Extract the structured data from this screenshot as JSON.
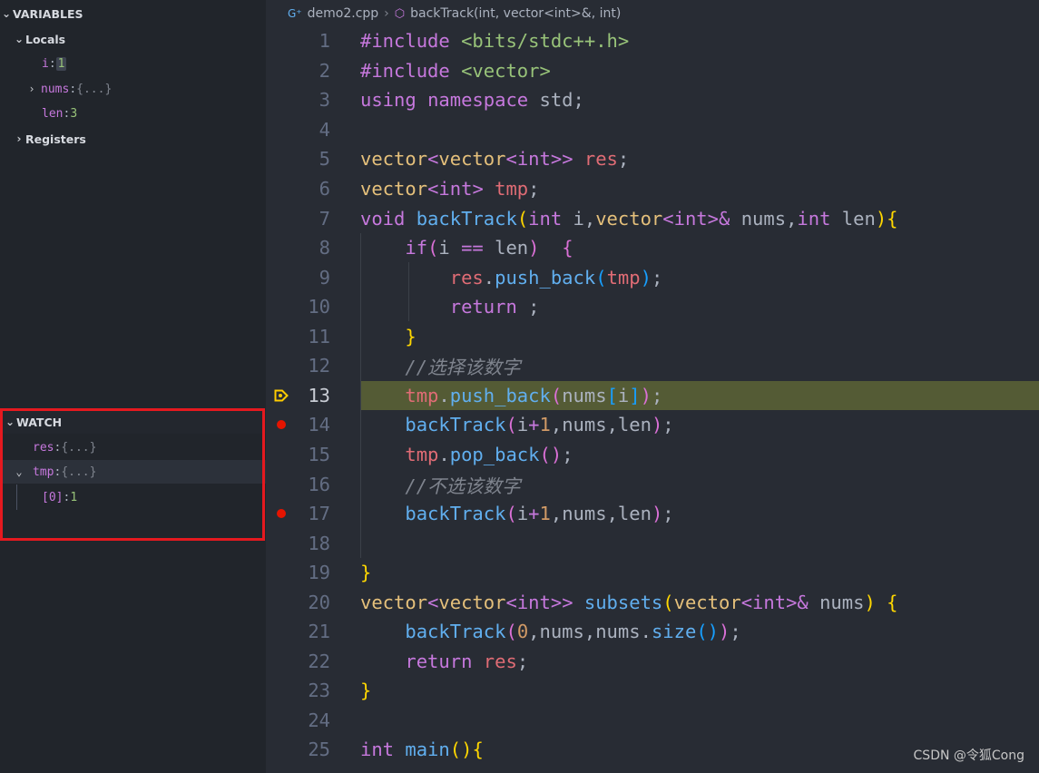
{
  "variables": {
    "title": "VARIABLES",
    "locals_label": "Locals",
    "locals": [
      {
        "name": "i",
        "value": "1"
      },
      {
        "name": "nums",
        "value": "{...}"
      },
      {
        "name": "len",
        "value": "3"
      }
    ],
    "registers_label": "Registers"
  },
  "watch": {
    "title": "WATCH",
    "items": [
      {
        "name": "res",
        "value": "{...}"
      },
      {
        "name": "tmp",
        "value": "{...}"
      },
      {
        "name": "[0]",
        "value": "1"
      }
    ]
  },
  "breadcrumb": {
    "file": "demo2.cpp",
    "symbol": "backTrack(int, vector<int>&, int)"
  },
  "editor": {
    "current_line": 13,
    "breakpoints": [
      14,
      17
    ],
    "lines": [
      {
        "n": "1",
        "text": "#include <bits/stdc++.h>"
      },
      {
        "n": "2",
        "text": "#include <vector>"
      },
      {
        "n": "3",
        "text": "using namespace std;"
      },
      {
        "n": "4",
        "text": ""
      },
      {
        "n": "5",
        "text": "vector<vector<int>> res;"
      },
      {
        "n": "6",
        "text": "vector<int> tmp;"
      },
      {
        "n": "7",
        "text": "void backTrack(int i,vector<int>& nums,int len){"
      },
      {
        "n": "8",
        "text": "    if(i == len)  {"
      },
      {
        "n": "9",
        "text": "        res.push_back(tmp);"
      },
      {
        "n": "10",
        "text": "        return ;"
      },
      {
        "n": "11",
        "text": "    }"
      },
      {
        "n": "12",
        "text": "    //选择该数字"
      },
      {
        "n": "13",
        "text": "    tmp.push_back(nums[i]);"
      },
      {
        "n": "14",
        "text": "    backTrack(i+1,nums,len);"
      },
      {
        "n": "15",
        "text": "    tmp.pop_back();"
      },
      {
        "n": "16",
        "text": "    //不选该数字"
      },
      {
        "n": "17",
        "text": "    backTrack(i+1,nums,len);"
      },
      {
        "n": "18",
        "text": ""
      },
      {
        "n": "19",
        "text": "}"
      },
      {
        "n": "20",
        "text": "vector<vector<int>> subsets(vector<int>& nums) {"
      },
      {
        "n": "21",
        "text": "    backTrack(0,nums,nums.size());"
      },
      {
        "n": "22",
        "text": "    return res;"
      },
      {
        "n": "23",
        "text": "}"
      },
      {
        "n": "24",
        "text": ""
      },
      {
        "n": "25",
        "text": "int main(){"
      }
    ]
  },
  "watermark": "CSDN @令狐Cong"
}
